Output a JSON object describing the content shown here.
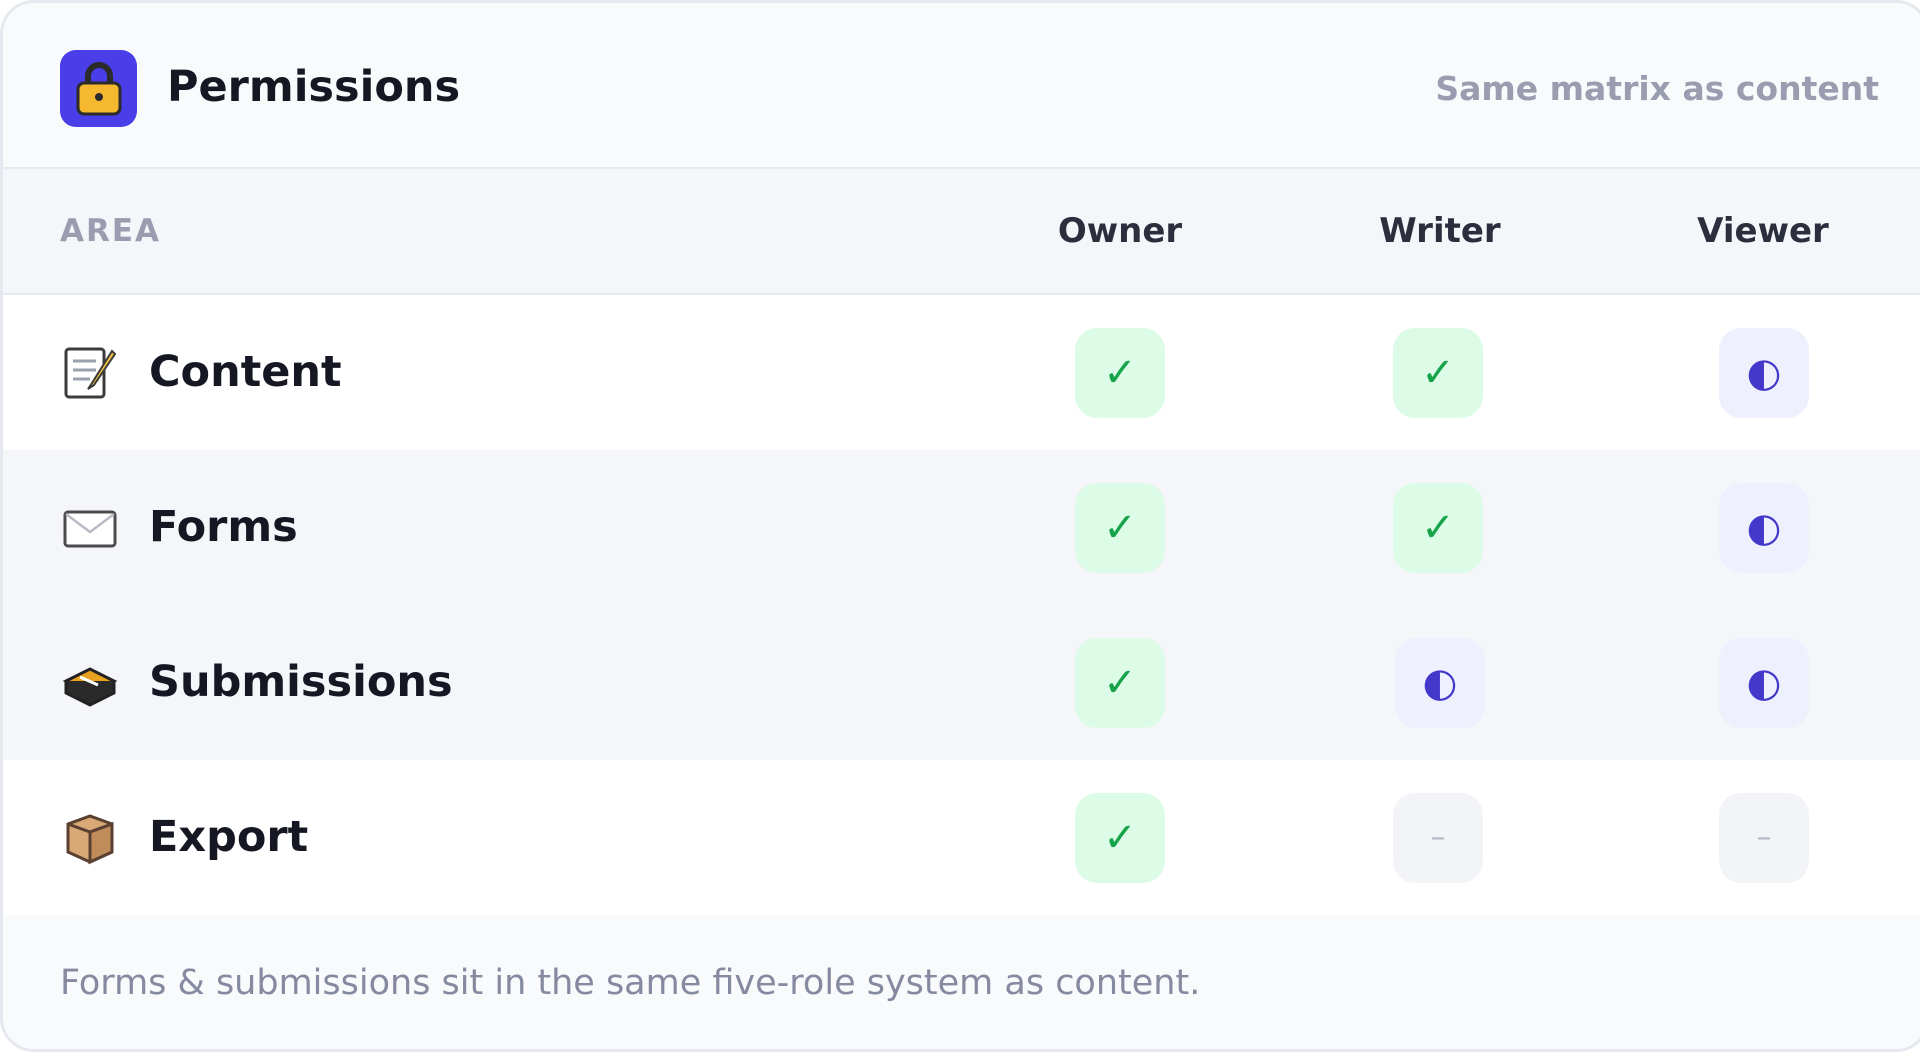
{
  "header": {
    "title": "Permissions",
    "subtitle": "Same matrix as content",
    "icon": "lock-icon",
    "accent": "#4a3ee8"
  },
  "table": {
    "area_header": "AREA",
    "roles": [
      "Owner",
      "Writer",
      "Viewer"
    ],
    "rows": [
      {
        "label": "Content",
        "icon": "memo-icon",
        "cells": [
          {
            "state": "full",
            "glyph": "✓"
          },
          {
            "state": "full",
            "glyph": "✓"
          },
          {
            "state": "partial",
            "glyph": "◐"
          }
        ]
      },
      {
        "label": "Forms",
        "icon": "envelope-icon",
        "cells": [
          {
            "state": "full",
            "glyph": "✓"
          },
          {
            "state": "full",
            "glyph": "✓"
          },
          {
            "state": "partial",
            "glyph": "◐"
          }
        ]
      },
      {
        "label": "Submissions",
        "icon": "inbox-tray-icon",
        "cells": [
          {
            "state": "full",
            "glyph": "✓"
          },
          {
            "state": "partial",
            "glyph": "◐"
          },
          {
            "state": "partial",
            "glyph": "◐"
          }
        ]
      },
      {
        "label": "Export",
        "icon": "package-icon",
        "cells": [
          {
            "state": "full",
            "glyph": "✓"
          },
          {
            "state": "none",
            "glyph": "–"
          },
          {
            "state": "none",
            "glyph": "–"
          }
        ]
      }
    ]
  },
  "footer": {
    "note": "Forms & submissions sit in the same five-role system as content."
  },
  "colors": {
    "full_bg": "#dcfce7",
    "full_fg": "#16a34a",
    "partial_bg": "#eef1fd",
    "partial_fg": "#4338ca",
    "none_bg": "#f3f4f7",
    "none_fg": "#b3b6c4"
  }
}
